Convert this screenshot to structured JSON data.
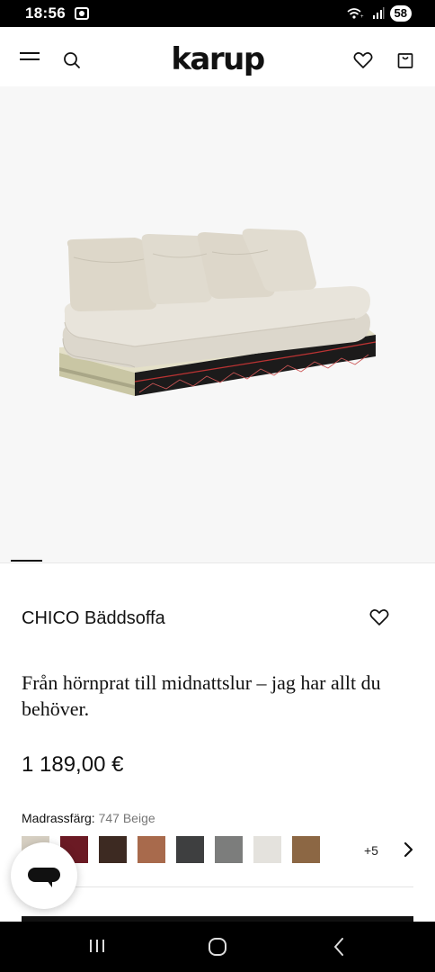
{
  "status_bar": {
    "time": "18:56",
    "battery": "58"
  },
  "header": {
    "logo": "karup",
    "icons": [
      "menu-icon",
      "search-icon",
      "heart-icon",
      "shopping-bag-icon"
    ]
  },
  "product": {
    "title": "CHICO Bäddsoffa",
    "tagline": "Från hörnprat till midnattslur – jag har allt du behöver.",
    "price": "1 189,00 €",
    "color_label": "Madrassfärg:",
    "color_value": "747 Beige",
    "swatches": [
      {
        "name": "beige",
        "color": "#d6cfc2"
      },
      {
        "name": "bordeaux",
        "color": "#6b1a24"
      },
      {
        "name": "dark-brown",
        "color": "#3d2a22"
      },
      {
        "name": "terracotta",
        "color": "#a86a4c"
      },
      {
        "name": "dark-grey",
        "color": "#3e3f40"
      },
      {
        "name": "grey",
        "color": "#7c7d7c"
      },
      {
        "name": "off-white",
        "color": "#e4e2dd"
      },
      {
        "name": "brown",
        "color": "#8c6744"
      }
    ],
    "more_swatches": "+5"
  },
  "colors": {
    "accent": "#111111",
    "image_background": "#f7f7f7"
  }
}
